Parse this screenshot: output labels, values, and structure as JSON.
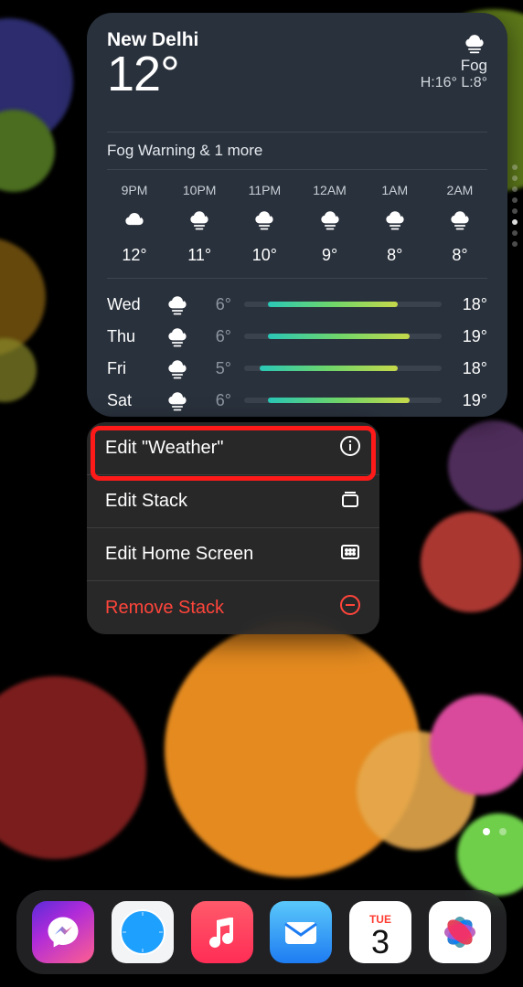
{
  "weather": {
    "city": "New Delhi",
    "current_temp": "12°",
    "condition": "Fog",
    "hi_lo": "H:16° L:8°",
    "alert": "Fog Warning & 1 more",
    "hourly": [
      {
        "time": "9PM",
        "icon": "cloud",
        "temp": "12°"
      },
      {
        "time": "10PM",
        "icon": "fog",
        "temp": "11°"
      },
      {
        "time": "11PM",
        "icon": "fog",
        "temp": "10°"
      },
      {
        "time": "12AM",
        "icon": "fog",
        "temp": "9°"
      },
      {
        "time": "1AM",
        "icon": "fog",
        "temp": "8°"
      },
      {
        "time": "2AM",
        "icon": "fog",
        "temp": "8°"
      }
    ],
    "daily": [
      {
        "day": "Wed",
        "icon": "fog",
        "lo": "6°",
        "hi": "18°",
        "bar_from": 12,
        "bar_to": 78
      },
      {
        "day": "Thu",
        "icon": "fog",
        "lo": "6°",
        "hi": "19°",
        "bar_from": 12,
        "bar_to": 84
      },
      {
        "day": "Fri",
        "icon": "fog",
        "lo": "5°",
        "hi": "18°",
        "bar_from": 8,
        "bar_to": 78
      },
      {
        "day": "Sat",
        "icon": "fog",
        "lo": "6°",
        "hi": "19°",
        "bar_from": 12,
        "bar_to": 84
      }
    ]
  },
  "menu": {
    "items": [
      {
        "label": "Edit \"Weather\"",
        "icon": "info",
        "danger": false,
        "highlight": true
      },
      {
        "label": "Edit Stack",
        "icon": "stack",
        "danger": false
      },
      {
        "label": "Edit Home Screen",
        "icon": "grid",
        "danger": false
      },
      {
        "label": "Remove Stack",
        "icon": "remove",
        "danger": true
      }
    ]
  },
  "dock": {
    "calendar_weekday": "TUE",
    "calendar_day": "3",
    "apps": [
      "messenger",
      "safari",
      "music",
      "mail",
      "calendar",
      "photos"
    ]
  }
}
